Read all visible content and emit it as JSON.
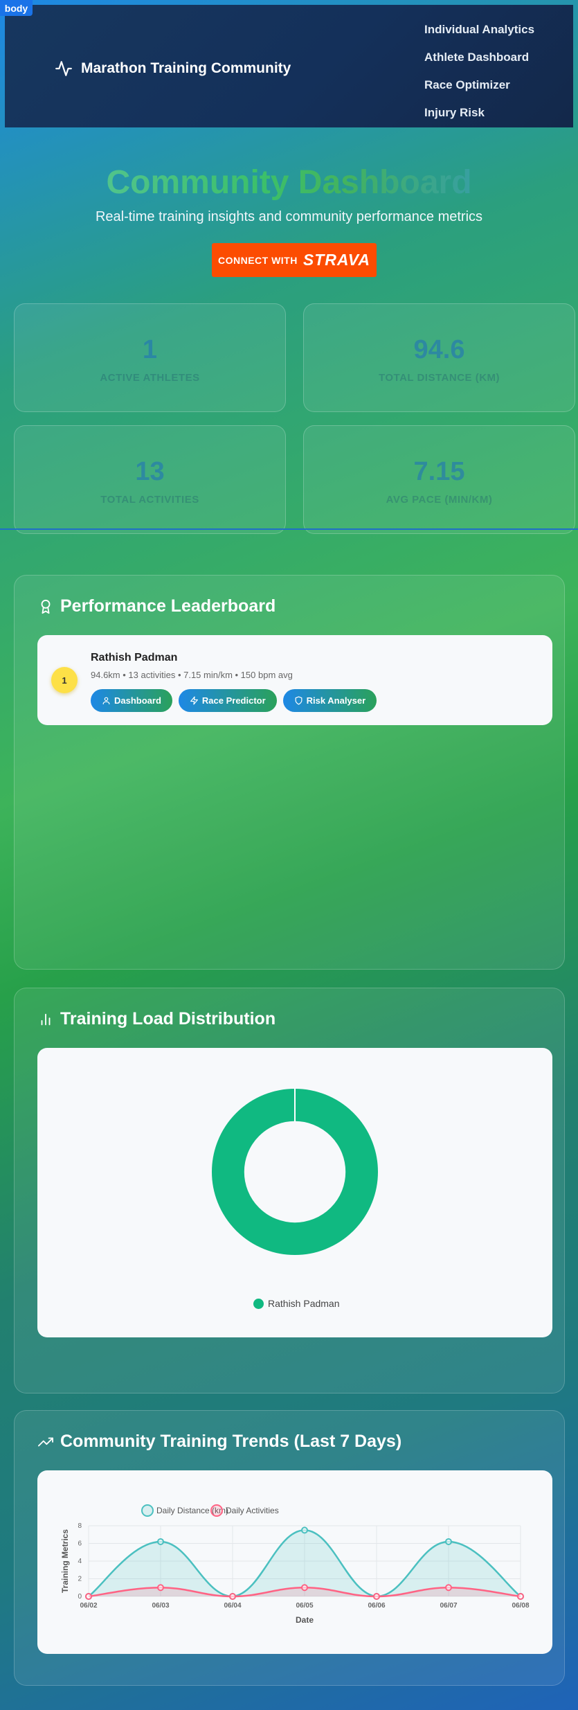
{
  "header": {
    "title": "Marathon Training Community",
    "nav": [
      "Individual Analytics",
      "Athlete Dashboard",
      "Race Optimizer",
      "Injury Risk"
    ]
  },
  "debug_tag": "body",
  "hero": {
    "title": "Community Dashboard",
    "subtitle": "Real-time training insights and community performance metrics",
    "connect_label": "CONNECT WITH",
    "strava_logo": "STRAVA"
  },
  "stats": [
    {
      "value": "1",
      "label": "Active Athletes"
    },
    {
      "value": "94.6",
      "label": "Total Distance (km)"
    },
    {
      "value": "13",
      "label": "Total Activities"
    },
    {
      "value": "7.15",
      "label": "Avg Pace (min/km)"
    }
  ],
  "leaderboard": {
    "title": "Performance Leaderboard",
    "entries": [
      {
        "rank": "1",
        "name": "Rathish Padman",
        "meta": "94.6km • 13 activities • 7.15 min/km • 150 bpm avg",
        "buttons": [
          "Dashboard",
          "Race Predictor",
          "Risk Analyser"
        ]
      }
    ]
  },
  "training_load": {
    "title": "Training Load Distribution",
    "legend": "Rathish Padman"
  },
  "trends": {
    "title": "Community Training Trends (Last 7 Days)"
  },
  "colors": {
    "strava": "#fc4c02",
    "donut": "#10b981",
    "distance": "#4bc0c0",
    "activities": "#ff6384",
    "rank_badge": "#fde047"
  },
  "chart_data": [
    {
      "type": "pie",
      "categories": [
        "Rathish Padman"
      ],
      "values": [
        100
      ],
      "title": ""
    },
    {
      "type": "area",
      "title": "",
      "x": [
        "06/02",
        "06/03",
        "06/04",
        "06/05",
        "06/06",
        "06/07",
        "06/08"
      ],
      "series": [
        {
          "name": "Daily Distance (km)",
          "values": [
            0,
            6.2,
            0,
            7.5,
            0,
            6.2,
            0
          ]
        },
        {
          "name": "Daily Activities",
          "values": [
            0,
            1,
            0,
            1,
            0,
            1,
            0
          ]
        }
      ],
      "xlabel": "Date",
      "ylabel": "Training Metrics",
      "ylim": [
        0,
        8
      ],
      "yticks": [
        "0",
        "2",
        "4",
        "6",
        "8"
      ],
      "grid": true,
      "legend": "top"
    }
  ]
}
